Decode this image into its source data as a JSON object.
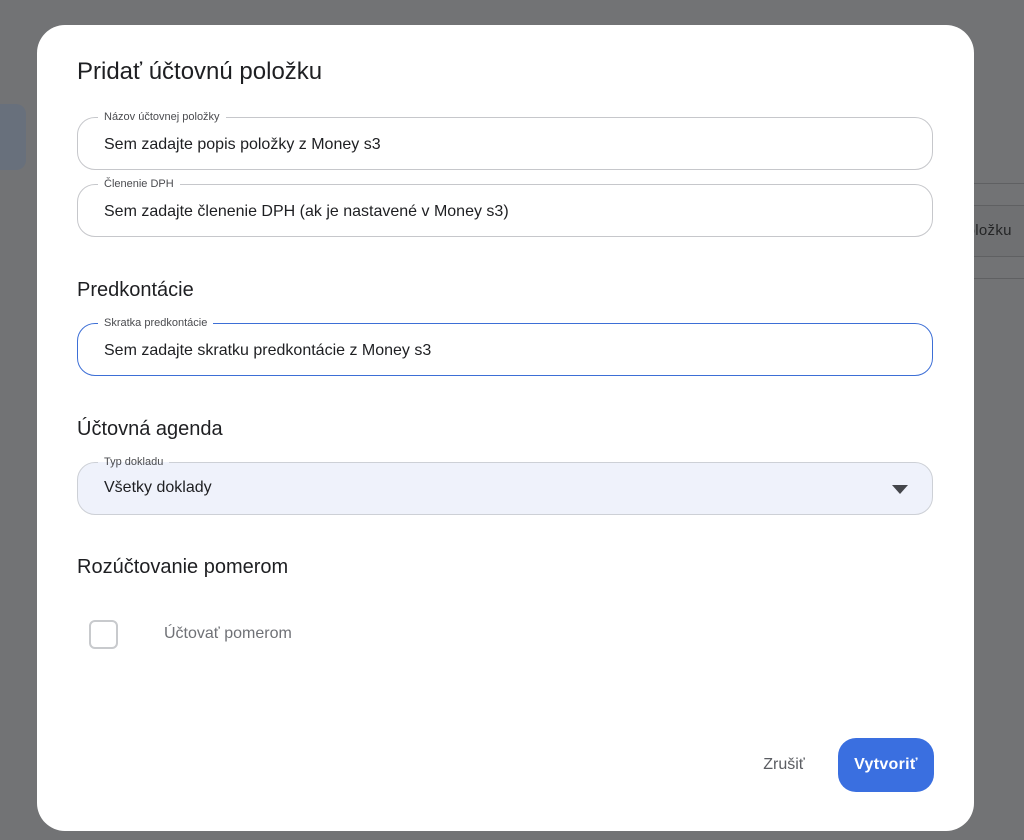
{
  "background": {
    "side_text": "položku"
  },
  "dialog": {
    "title": "Pridať účtovnú položku",
    "fields": {
      "item_name": {
        "label": "Názov účtovnej položky",
        "value": "Sem zadajte popis položky z Money s3"
      },
      "vat": {
        "label": "Členenie DPH",
        "value": "Sem zadajte členenie DPH  (ak je nastavené v Money s3)"
      }
    },
    "predkontacie": {
      "heading": "Predkontácie",
      "field": {
        "label": "Skratka predkontácie",
        "value": "Sem zadajte skratku predkontácie z Money s3"
      }
    },
    "agenda": {
      "heading": "Účtovná agenda",
      "select": {
        "label": "Typ dokladu",
        "value": "Všetky doklady"
      }
    },
    "rozuctovanie": {
      "heading": "Rozúčtovanie pomerom",
      "checkbox_label": "Účtovať pomerom",
      "checked": false
    },
    "actions": {
      "cancel": "Zrušiť",
      "create": "Vytvoriť"
    }
  },
  "colors": {
    "primary": "#3a6fe0",
    "focus_border": "#3d6fd6",
    "overlay": "#727375"
  }
}
